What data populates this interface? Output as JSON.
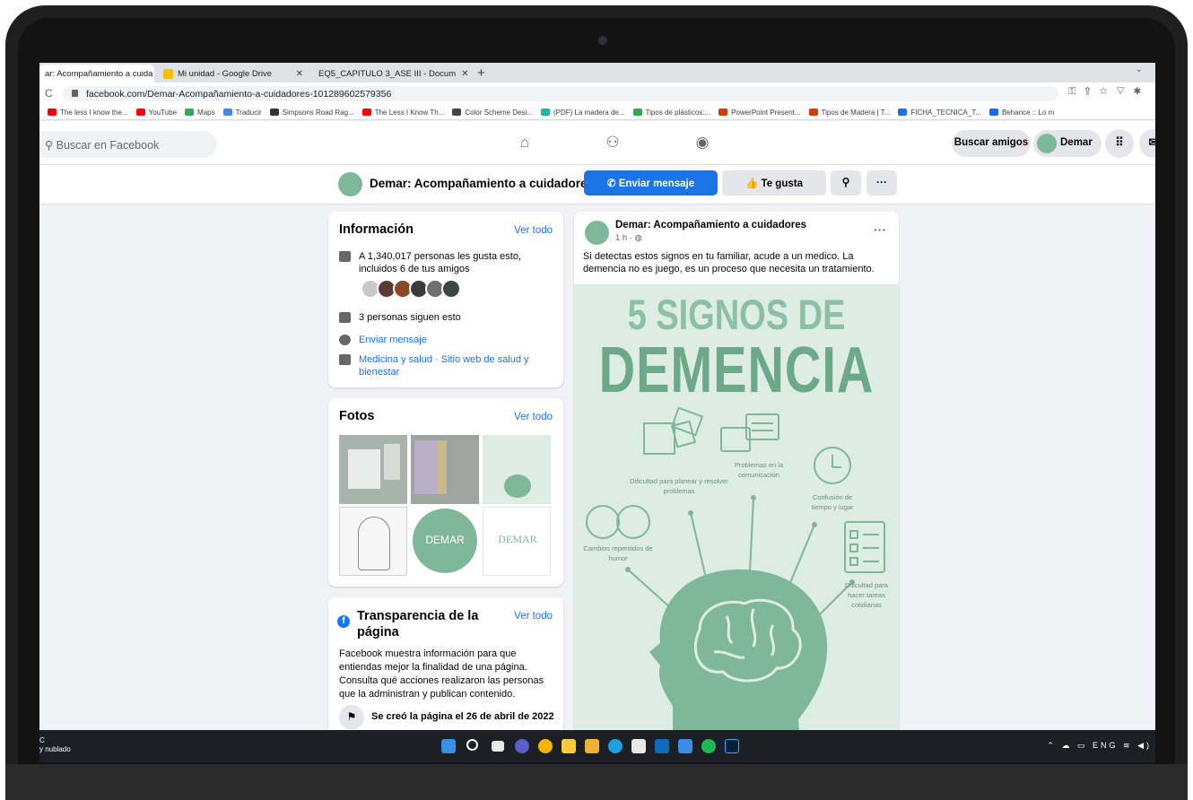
{
  "browser": {
    "tabs": [
      {
        "title": "ar: Acompañamiento a cuida",
        "active": true,
        "icon_color": "#1877f2"
      },
      {
        "title": "Mi unidad - Google Drive",
        "active": false,
        "icon_color": "#fbbc04"
      },
      {
        "title": "EQ5_CAPITULO 3_ASE III - Docum",
        "active": false,
        "icon_color": "#4285f4"
      }
    ],
    "new_tab": "+",
    "url": "facebook.com/Demar-Acompañamiento-a-cuidadores-101289602579356",
    "bookmarks": [
      {
        "label": "The less I know the...",
        "color": "#ff0000"
      },
      {
        "label": "YouTube",
        "color": "#ff0000"
      },
      {
        "label": "Maps",
        "color": "#34a853"
      },
      {
        "label": "Traducir",
        "color": "#4285f4"
      },
      {
        "label": "Simpsons Road Rag...",
        "color": "#333333"
      },
      {
        "label": "The Less I Know Th...",
        "color": "#ff0000"
      },
      {
        "label": "Color Scheme Desi...",
        "color": "#444444"
      },
      {
        "label": "(PDF) La madera de...",
        "color": "#1fb6a6"
      },
      {
        "label": "Tipos de plásticos:...",
        "color": "#34a853"
      },
      {
        "label": "PowerPoint Present...",
        "color": "#d83b01"
      },
      {
        "label": "Tipos de Madera | T...",
        "color": "#d83b01"
      },
      {
        "label": "FICHA_TECNICA_T...",
        "color": "#1a73e8"
      },
      {
        "label": "Behance :: Lo m",
        "color": "#1769ff"
      }
    ]
  },
  "fb_nav": {
    "search_placeholder": "Buscar en Facebook",
    "find_friends": "Buscar amigos",
    "profile_name": "Demar"
  },
  "page_bar": {
    "name": "Demar: Acompañamiento a cuidadores",
    "message_button": "Enviar mensaje",
    "like_button": "Te gusta",
    "more": "···"
  },
  "info_card": {
    "title": "Información",
    "see_all": "Ver todo",
    "likes_text": "A 1,340,017 personas les gusta esto, incluidos 6 de tus amigos",
    "followers_text": "3 personas siguen esto",
    "send_message": "Enviar mensaje",
    "category": "Medicina y salud · Sitio web de salud y bienestar"
  },
  "photos_card": {
    "title": "Fotos",
    "see_all": "Ver todo",
    "logo_text": "DEMAR"
  },
  "transparency_card": {
    "title": "Transparencia de la página",
    "see_all": "Ver todo",
    "body": "Facebook muestra información para que entiendas mejor la finalidad de una página. Consulta qué acciones realizaron las personas que la administran y publican contenido.",
    "created": "Se creó la página el 26 de abril de 2022"
  },
  "post": {
    "author": "Demar: Acompañamiento a cuidadores",
    "time": "1 h · ",
    "more": "···",
    "text": "Si detectas estos signos en tu familiar, acude a un medico. La demencia no es juego, es un proceso que necesita un tratamiento.",
    "infographic": {
      "title_line1": "5 SIGNOS DE",
      "title_line2": "DEMENCIA",
      "signs": [
        "Dificultad para planear y resolver problemas",
        "Problemas en la comunicación",
        "Confusión de tiempo y lugar",
        "Cambios repentidos de humor",
        "Dificultad para hacer tareas cotidianas"
      ],
      "colors": {
        "background": "#deede4",
        "accent": "#7fb79a",
        "dark": "#6ca98a"
      }
    }
  },
  "taskbar": {
    "weather_line1": "C",
    "weather_line2": "y nublado",
    "lang": "ENG"
  },
  "colors": {
    "fb_blue": "#1b74e4",
    "fb_bg": "#f0f2f5",
    "demar_green": "#7fb79a"
  }
}
